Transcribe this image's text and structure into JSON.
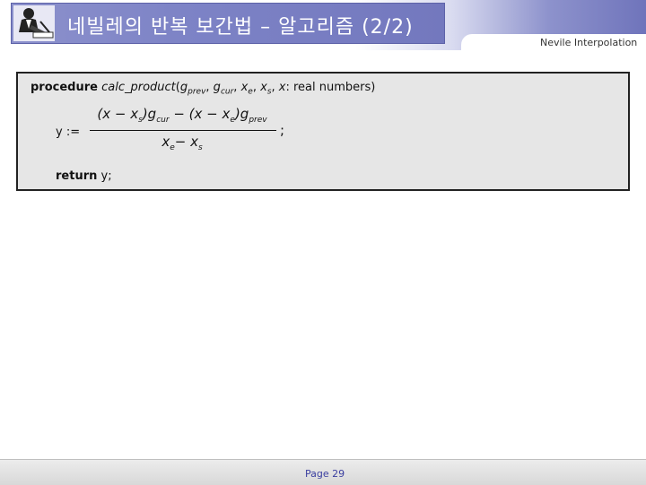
{
  "header": {
    "title": "네빌레의 반복 보간법 – 알고리즘 (2/2)",
    "right_label": "Nevile Interpolation"
  },
  "algorithm": {
    "keyword_procedure": "procedure",
    "proc_name": "calc_product",
    "params_open": "(",
    "p_g": "g",
    "p_prev_sub": "prev",
    "p_sep1": ", ",
    "p_g2": "g",
    "p_cur_sub": "cur",
    "p_sep2": ", ",
    "p_x1": "x",
    "p_e_sub": "e",
    "p_sep3": ", ",
    "p_x2": "x",
    "p_s_sub": "s",
    "p_sep4": ", ",
    "p_x3": "x",
    "params_rest": ": real numbers)",
    "assign_label": "y :=",
    "numerator": "(x − x",
    "num_s": "s",
    "num_mid": ")g",
    "num_cur": "cur",
    "num_minus": " − (x − x",
    "num_e": "e",
    "num_end": ")g",
    "num_prev": "prev",
    "denominator": "x",
    "den_e": "e",
    "den_minus": "− x",
    "den_s": "s",
    "semicolon": ";",
    "keyword_return": "return",
    "return_rest": " y;"
  },
  "footer": {
    "page": "Page 29"
  }
}
